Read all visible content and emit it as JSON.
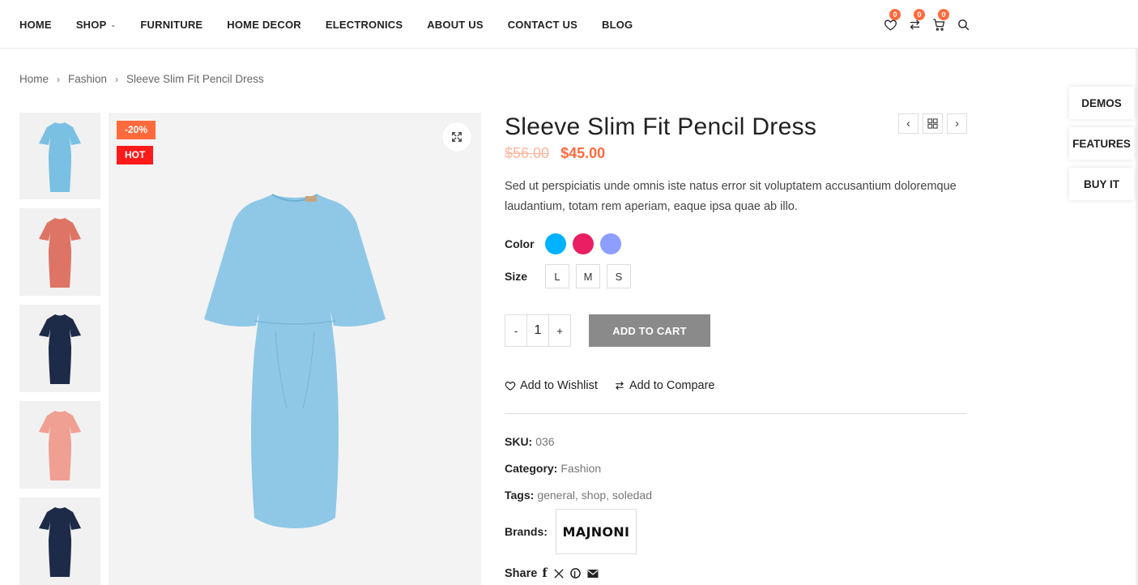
{
  "nav": {
    "items": [
      {
        "label": "HOME"
      },
      {
        "label": "SHOP"
      },
      {
        "label": "FURNITURE"
      },
      {
        "label": "HOME DECOR"
      },
      {
        "label": "ELECTRONICS"
      },
      {
        "label": "ABOUT US"
      },
      {
        "label": "CONTACT US"
      },
      {
        "label": "BLOG"
      }
    ]
  },
  "header_icons": {
    "wishlist_count": "0",
    "compare_count": "0",
    "cart_count": "0"
  },
  "breadcrumb": [
    "Home",
    "Fashion",
    "Sleeve Slim Fit Pencil Dress"
  ],
  "thumbnails": [
    {
      "color": "#7ac0e3"
    },
    {
      "color": "#dd7466"
    },
    {
      "color": "#1d2a48"
    },
    {
      "color": "#f0a092"
    },
    {
      "color": "#1d2a48"
    }
  ],
  "badges": {
    "sale": "-20%",
    "hot": "HOT"
  },
  "product": {
    "title": "Sleeve Slim Fit Pencil Dress",
    "old_price": "$56.00",
    "new_price": "$45.00",
    "description": "Sed ut perspiciatis unde omnis iste natus error sit voluptatem accusantium doloremque laudantium, totam rem aperiam, eaque ipsa quae ab illo.",
    "color_label": "Color",
    "colors": [
      "#00b2ff",
      "#e91e63",
      "#8c9eff"
    ],
    "size_label": "Size",
    "sizes": [
      "L",
      "M",
      "S"
    ],
    "qty_minus": "-",
    "qty_value": "1",
    "qty_plus": "+",
    "add_to_cart": "ADD TO CART",
    "wishlist": "Add to Wishlist",
    "compare": "Add to Compare",
    "sku_label": "SKU:",
    "sku": "036",
    "category_label": "Category:",
    "category": "Fashion",
    "tags_label": "Tags:",
    "tags": "general, shop, soledad",
    "brands_label": "Brands:",
    "brand": "MAJNONI",
    "share_label": "Share"
  },
  "side_panel": [
    "DEMOS",
    "FEATURES",
    "BUY IT"
  ],
  "colors": {
    "accent": "#ff6a3d",
    "hot": "#ff1a1a",
    "button": "#8a8a8a"
  }
}
